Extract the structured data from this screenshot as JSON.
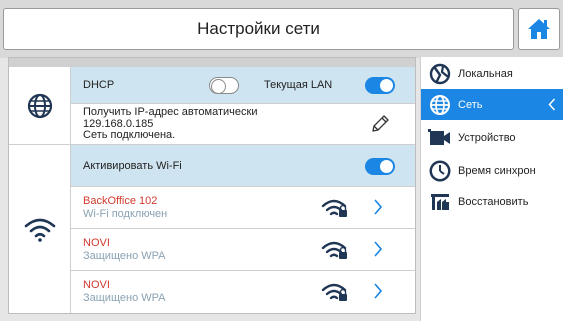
{
  "header": {
    "title": "Настройки сети",
    "home_icon": "home-icon"
  },
  "lan": {
    "icon": "globe-icon",
    "dhcp_label": "DHCP",
    "dhcp_enabled": false,
    "current_lan_label": "Текущая LAN",
    "current_lan_enabled": true,
    "ip_line1": "Получить IP-адрес автоматически",
    "ip_line2": "129.168.0.185",
    "ip_line3": "Сеть подключена."
  },
  "wifi": {
    "icon": "wifi-icon",
    "activate_label": "Активировать Wi-Fi",
    "activate_enabled": true,
    "networks": [
      {
        "name": "BackOffice 102",
        "status": "Wi-Fi подключен"
      },
      {
        "name": "NOVI",
        "status": "Защищено WPA"
      },
      {
        "name": "NOVI",
        "status": "Защищено WPA"
      }
    ]
  },
  "sidebar": {
    "items": [
      {
        "label": "Локальная",
        "icon": "locale-icon"
      },
      {
        "label": "Сеть",
        "icon": "globe-icon",
        "active": true
      },
      {
        "label": "Устройство",
        "icon": "camera-icon"
      },
      {
        "label": "Время синхрон",
        "icon": "clock-icon"
      },
      {
        "label": "Восстановить",
        "icon": "factory-icon"
      }
    ]
  },
  "colors": {
    "accent": "#1b86e3",
    "row_highlight": "#cfe4f1",
    "network_name": "#d23a2e",
    "network_status": "#8aa2b3",
    "icon_dark": "#1f3654"
  }
}
